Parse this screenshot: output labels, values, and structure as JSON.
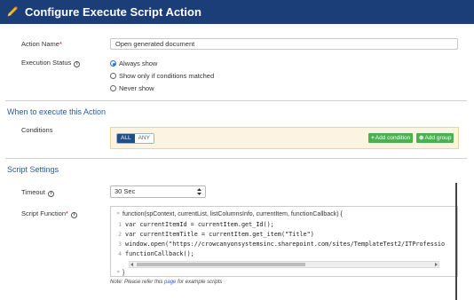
{
  "header": {
    "title": "Configure Execute Script Action",
    "icon": "pencil-icon",
    "background": "#1b3e78"
  },
  "action_name": {
    "label": "Action Name",
    "required_mark": "*",
    "value": "Open generated document"
  },
  "execution_status": {
    "label": "Execution Status",
    "info_icon": "info-icon",
    "options": [
      {
        "label": "Always show",
        "selected": true
      },
      {
        "label": "Show only if conditions matched",
        "selected": false
      },
      {
        "label": "Never show",
        "selected": false
      }
    ]
  },
  "when_section": {
    "title": "When to execute this Action",
    "conditions_label": "Conditions",
    "toggle_all": "ALL",
    "toggle_any": "ANY",
    "add_condition": "Add condition",
    "add_group": "Add group"
  },
  "script_settings": {
    "title": "Script Settings",
    "timeout": {
      "label": "Timeout",
      "value": "30 Sec"
    },
    "script_function": {
      "label": "Script Function",
      "required_mark": "*",
      "signature": "function(spContext, currentList, listColumnsInfo, currentItem, functionCallback) {",
      "lines": [
        {
          "num": "1",
          "text": "var currentItemId = currentItem.get_Id();"
        },
        {
          "num": "2",
          "text": "var currentItemTitle = currentItem.get_item(\"Title\")"
        },
        {
          "num": "3",
          "text": "window.open(\"https://crowcanyonsystemsinc.sharepoint.com/sites/TemplateTest2/ITProfessio"
        },
        {
          "num": "4",
          "text": "functionCallback();"
        }
      ],
      "closing": "}"
    },
    "note": {
      "prefix": "Note: Please refer this ",
      "link": "page",
      "suffix": " for example scripts"
    }
  },
  "colors": {
    "accent_green": "#4caf50",
    "section_blue": "#2a5b9f",
    "toggle_active": "#1f4e8a",
    "conditions_bg": "#fdf3e1"
  }
}
